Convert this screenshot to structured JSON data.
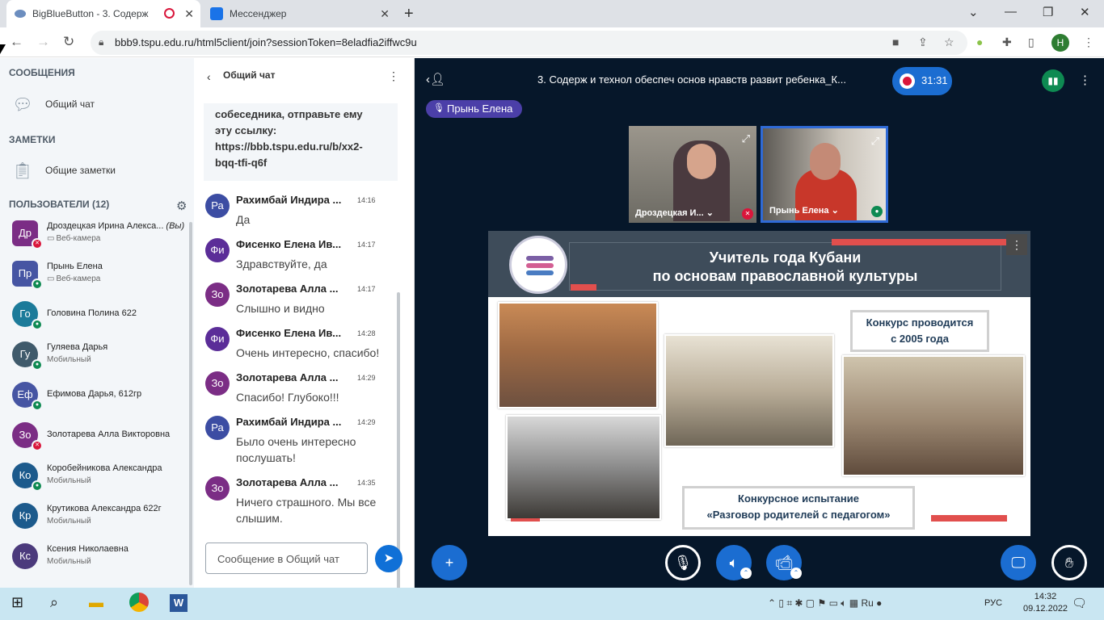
{
  "browser": {
    "tabs": [
      {
        "title": "BigBlueButton - 3. Содерж",
        "active": true
      },
      {
        "title": "Мессенджер",
        "active": false
      }
    ],
    "url": "bbb9.tspu.edu.ru/html5client/join?sessionToken=8eladfia2iffwc9u",
    "profile_initial": "H"
  },
  "sidebar": {
    "messages_header": "СООБЩЕНИЯ",
    "public_chat": "Общий чат",
    "notes_header": "ЗАМЕТКИ",
    "shared_notes": "Общие заметки",
    "users_header": "ПОЛЬЗОВАТЕЛИ (12)",
    "users": [
      {
        "initials": "Др",
        "name": "Дроздецкая Ирина Алекса...",
        "you": "(Вы)",
        "status": "Веб-камера",
        "color": "#7b2d85",
        "badge": "muted",
        "shape": "square"
      },
      {
        "initials": "Пр",
        "name": "Прынь Елена",
        "status": "Веб-камера",
        "color": "#4655a3",
        "badge": "talking",
        "shape": "square"
      },
      {
        "initials": "Го",
        "name": "Головина Полина 622",
        "status": "",
        "color": "#1c7b9a",
        "badge": "listen",
        "shape": "round"
      },
      {
        "initials": "Гу",
        "name": "Гуляева Дарья",
        "status": "Мобильный",
        "color": "#3f5a6b",
        "badge": "listen",
        "shape": "round"
      },
      {
        "initials": "Еф",
        "name": "Ефимова Дарья, 612гр",
        "status": "",
        "color": "#4655a3",
        "badge": "listen",
        "shape": "round"
      },
      {
        "initials": "Зо",
        "name": "Золотарева Алла Викторовна",
        "status": "",
        "color": "#7b2d85",
        "badge": "muted",
        "shape": "round"
      },
      {
        "initials": "Ко",
        "name": "Коробейникова Александра",
        "status": "Мобильный",
        "color": "#1c5a8c",
        "badge": "listen",
        "shape": "round"
      },
      {
        "initials": "Кр",
        "name": "Крутикова Александра 622г",
        "status": "Мобильный",
        "color": "#1c5a8c",
        "badge": "",
        "shape": "round"
      },
      {
        "initials": "Кс",
        "name": "Ксения Николаевна",
        "status": "Мобильный",
        "color": "#4b3a7c",
        "badge": "",
        "shape": "round"
      }
    ]
  },
  "chat": {
    "title": "Общий чат",
    "welcome_lines": [
      "собеседника, отправьте ему",
      "эту ссылку:",
      "https://bbb.tspu.edu.ru/b/xx2-",
      "bqq-tfi-q6f"
    ],
    "messages": [
      {
        "initials": "Ра",
        "author": "Рахимбай Индира ...",
        "time": "14:16",
        "text": "Да",
        "color": "#3c4da3"
      },
      {
        "initials": "Фи",
        "author": "Фисенко Елена Ив...",
        "time": "14:17",
        "text": "Здравствуйте, да",
        "color": "#5b2d98"
      },
      {
        "initials": "Зо",
        "author": "Золотарева Алла ...",
        "time": "14:17",
        "text": "Слышно и видно",
        "color": "#7b2d85"
      },
      {
        "initials": "Фи",
        "author": "Фисенко Елена Ив...",
        "time": "14:28",
        "text": "Очень интересно, спасибо!",
        "color": "#5b2d98"
      },
      {
        "initials": "Зо",
        "author": "Золотарева Алла ...",
        "time": "14:29",
        "text": "Спасибо! Глубоко!!!",
        "color": "#7b2d85"
      },
      {
        "initials": "Ра",
        "author": "Рахимбай Индира ...",
        "time": "14:29",
        "text": "Было очень интересно послушать!",
        "color": "#3c4da3"
      },
      {
        "initials": "Зо",
        "author": "Золотарева Алла ...",
        "time": "14:35",
        "text": "Ничего страшного. Мы все слышим.",
        "color": "#7b2d85"
      }
    ],
    "input_placeholder": "Сообщение в Общий чат"
  },
  "stage": {
    "meeting_title": "3. Содерж и технол обеспеч основ нравств развит ребенка_К...",
    "recording_time": "31:31",
    "talking_user": "Прынь Елена",
    "cams": [
      {
        "label": "Дроздецкая И... ⌄"
      },
      {
        "label": "Прынь Елена ⌄"
      }
    ]
  },
  "slide": {
    "title_line1": "Учитель года Кубани",
    "title_line2": "по основам православной культуры",
    "caption_year_1": "Конкурс проводится",
    "caption_year_2": "с 2005 года",
    "caption_test_1": "Конкурсное испытание",
    "caption_test_2": "«Разговор родителей с педагогом»"
  },
  "taskbar": {
    "lang": "РУС",
    "time": "14:32",
    "date": "09.12.2022"
  },
  "colors": {
    "accent": "#0f70d7",
    "stage_bg": "#06172a",
    "slide_header": "#3e4c5a",
    "slide_red": "#e14f4d"
  }
}
